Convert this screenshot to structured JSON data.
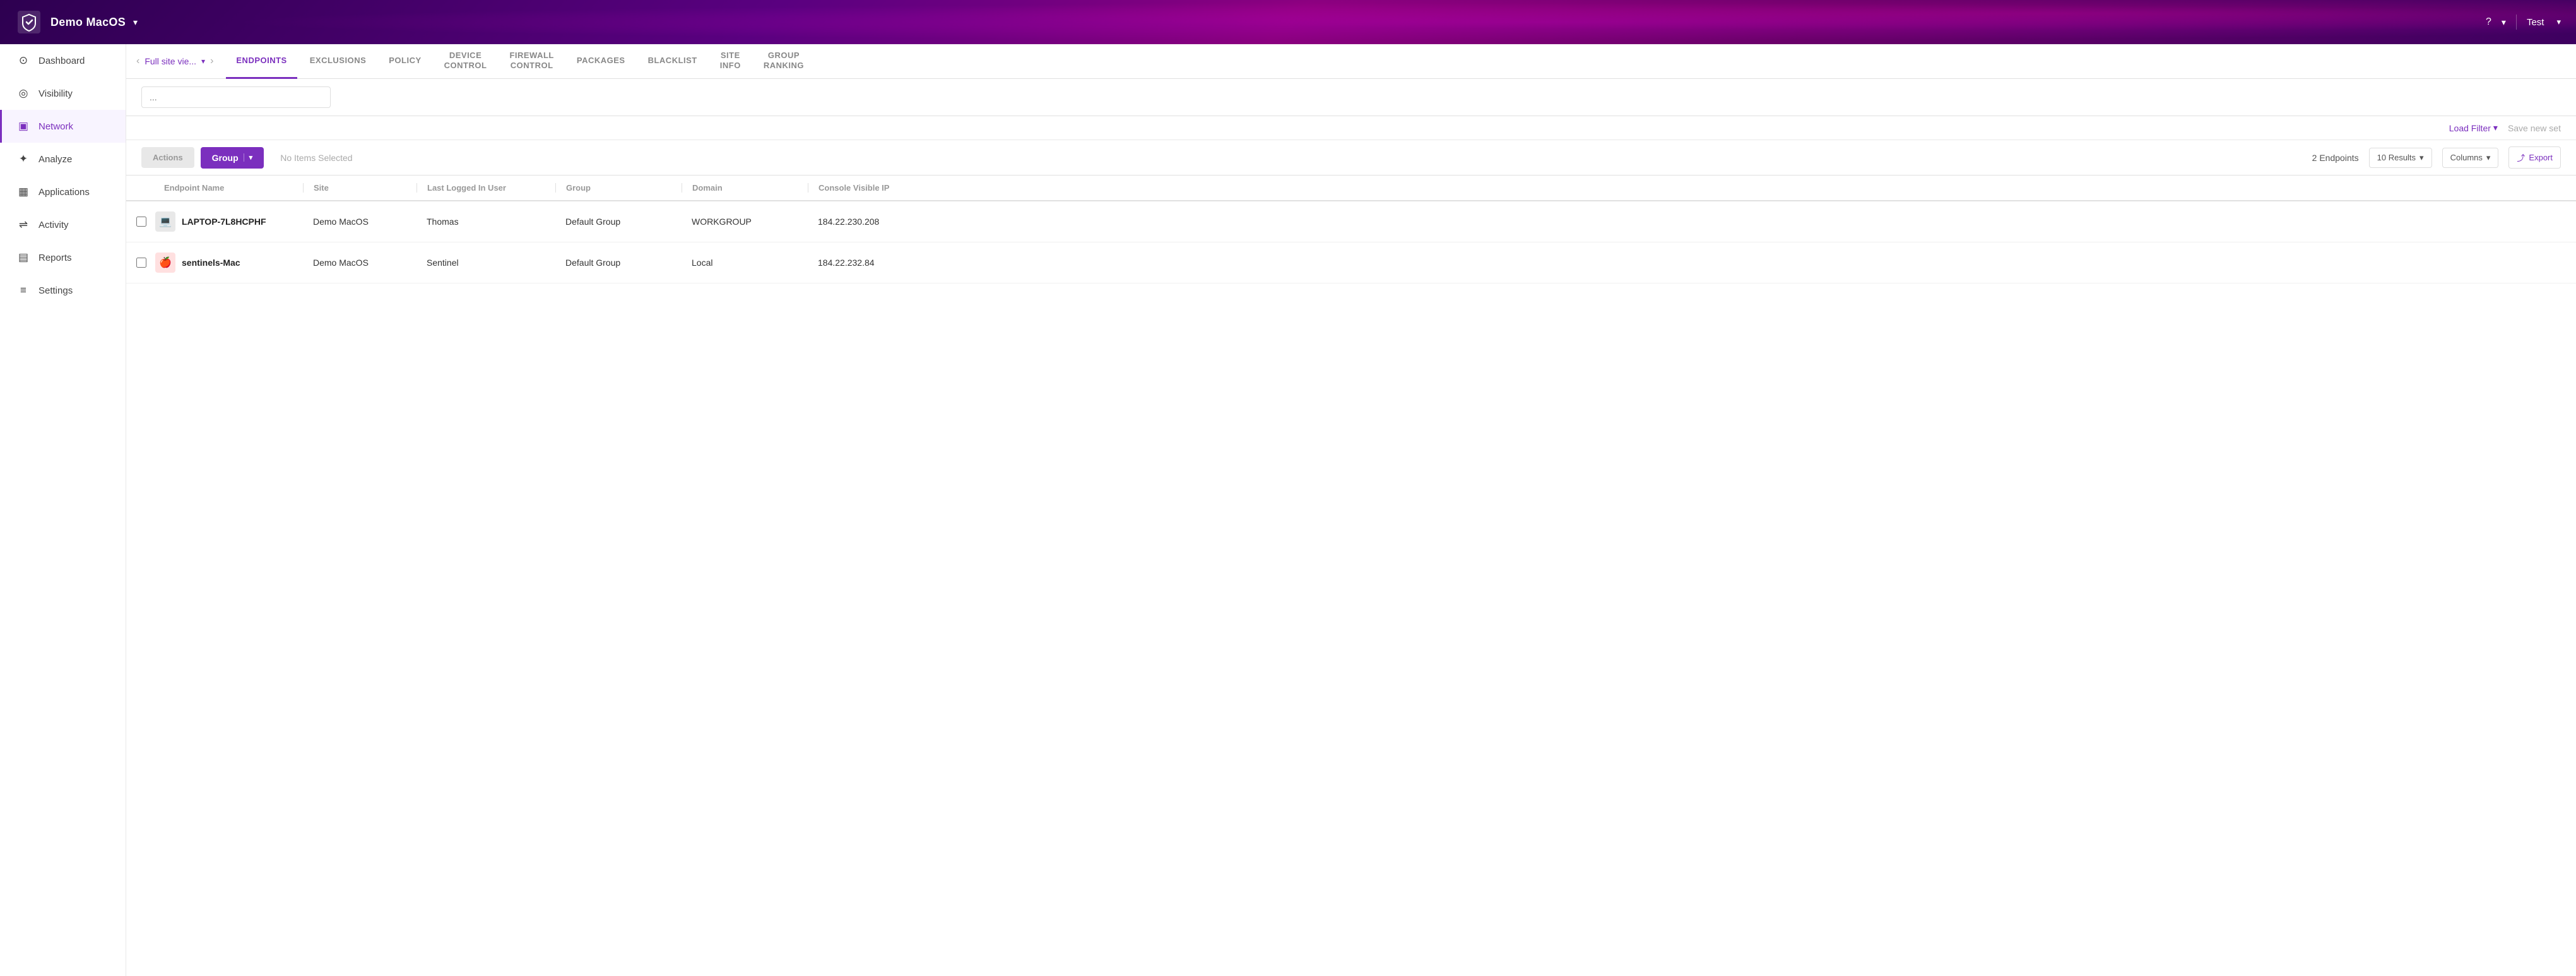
{
  "header": {
    "logo_alt": "SentinelOne Logo",
    "site_name": "Demo MacOS",
    "dropdown_label": "▾",
    "help_label": "?",
    "chevron_label": "▾",
    "user_label": "Test",
    "user_arrow": "▾"
  },
  "sidebar": {
    "items": [
      {
        "id": "dashboard",
        "label": "Dashboard",
        "icon": "⊙"
      },
      {
        "id": "visibility",
        "label": "Visibility",
        "icon": "◎"
      },
      {
        "id": "network",
        "label": "Network",
        "icon": "▣",
        "active": true
      },
      {
        "id": "analyze",
        "label": "Analyze",
        "icon": "✦"
      },
      {
        "id": "applications",
        "label": "Applications",
        "icon": "▦"
      },
      {
        "id": "activity",
        "label": "Activity",
        "icon": "⇌"
      },
      {
        "id": "reports",
        "label": "Reports",
        "icon": "▤"
      },
      {
        "id": "settings",
        "label": "Settings",
        "icon": "≡"
      }
    ]
  },
  "tabs": {
    "breadcrumb_text": "Full site vie...",
    "breadcrumb_dropdown": "▾",
    "items": [
      {
        "id": "endpoints",
        "label": "ENDPOINTS",
        "active": true
      },
      {
        "id": "exclusions",
        "label": "EXCLUSIONS",
        "active": false
      },
      {
        "id": "policy",
        "label": "POLICY",
        "active": false
      },
      {
        "id": "device-control",
        "label": "DEVICE\nCONTROL",
        "active": false
      },
      {
        "id": "firewall-control",
        "label": "FIREWALL\nCONTROL",
        "active": false
      },
      {
        "id": "packages",
        "label": "PACKAGES",
        "active": false
      },
      {
        "id": "blacklist",
        "label": "BLACKLIST",
        "active": false
      },
      {
        "id": "site-info",
        "label": "SITE\nINFO",
        "active": false
      },
      {
        "id": "group-ranking",
        "label": "GROUP\nRANKING",
        "active": false
      }
    ]
  },
  "filter_bar": {
    "placeholder": "..."
  },
  "filter_save": {
    "load_filter_label": "Load Filter",
    "load_filter_arrow": "▾",
    "save_new_set_label": "Save new set"
  },
  "actions_bar": {
    "actions_button_label": "Actions",
    "group_button_label": "Group",
    "group_button_arrow": "▾",
    "no_items_label": "No Items Selected",
    "endpoints_count": "2 Endpoints",
    "results_label": "10 Results",
    "results_arrow": "▾",
    "columns_label": "Columns",
    "columns_arrow": "▾",
    "export_icon": "⤴",
    "export_label": "Export"
  },
  "table": {
    "columns": [
      {
        "id": "endpoint-name",
        "label": "Endpoint Name"
      },
      {
        "id": "site",
        "label": "Site"
      },
      {
        "id": "last-logged-in-user",
        "label": "Last Logged In User"
      },
      {
        "id": "group",
        "label": "Group"
      },
      {
        "id": "domain",
        "label": "Domain"
      },
      {
        "id": "console-visible-ip",
        "label": "Console Visible IP"
      }
    ],
    "rows": [
      {
        "endpoint_name": "LAPTOP-7L8HCPHF",
        "site": "Demo MacOS",
        "last_logged_in_user": "Thomas",
        "group": "Default Group",
        "domain": "WORKGROUP",
        "console_visible_ip": "184.22.230.208",
        "icon_type": "windows"
      },
      {
        "endpoint_name": "sentinels-Mac",
        "site": "Demo MacOS",
        "last_logged_in_user": "Sentinel",
        "group": "Default Group",
        "domain": "Local",
        "console_visible_ip": "184.22.232.84",
        "icon_type": "mac"
      }
    ]
  }
}
